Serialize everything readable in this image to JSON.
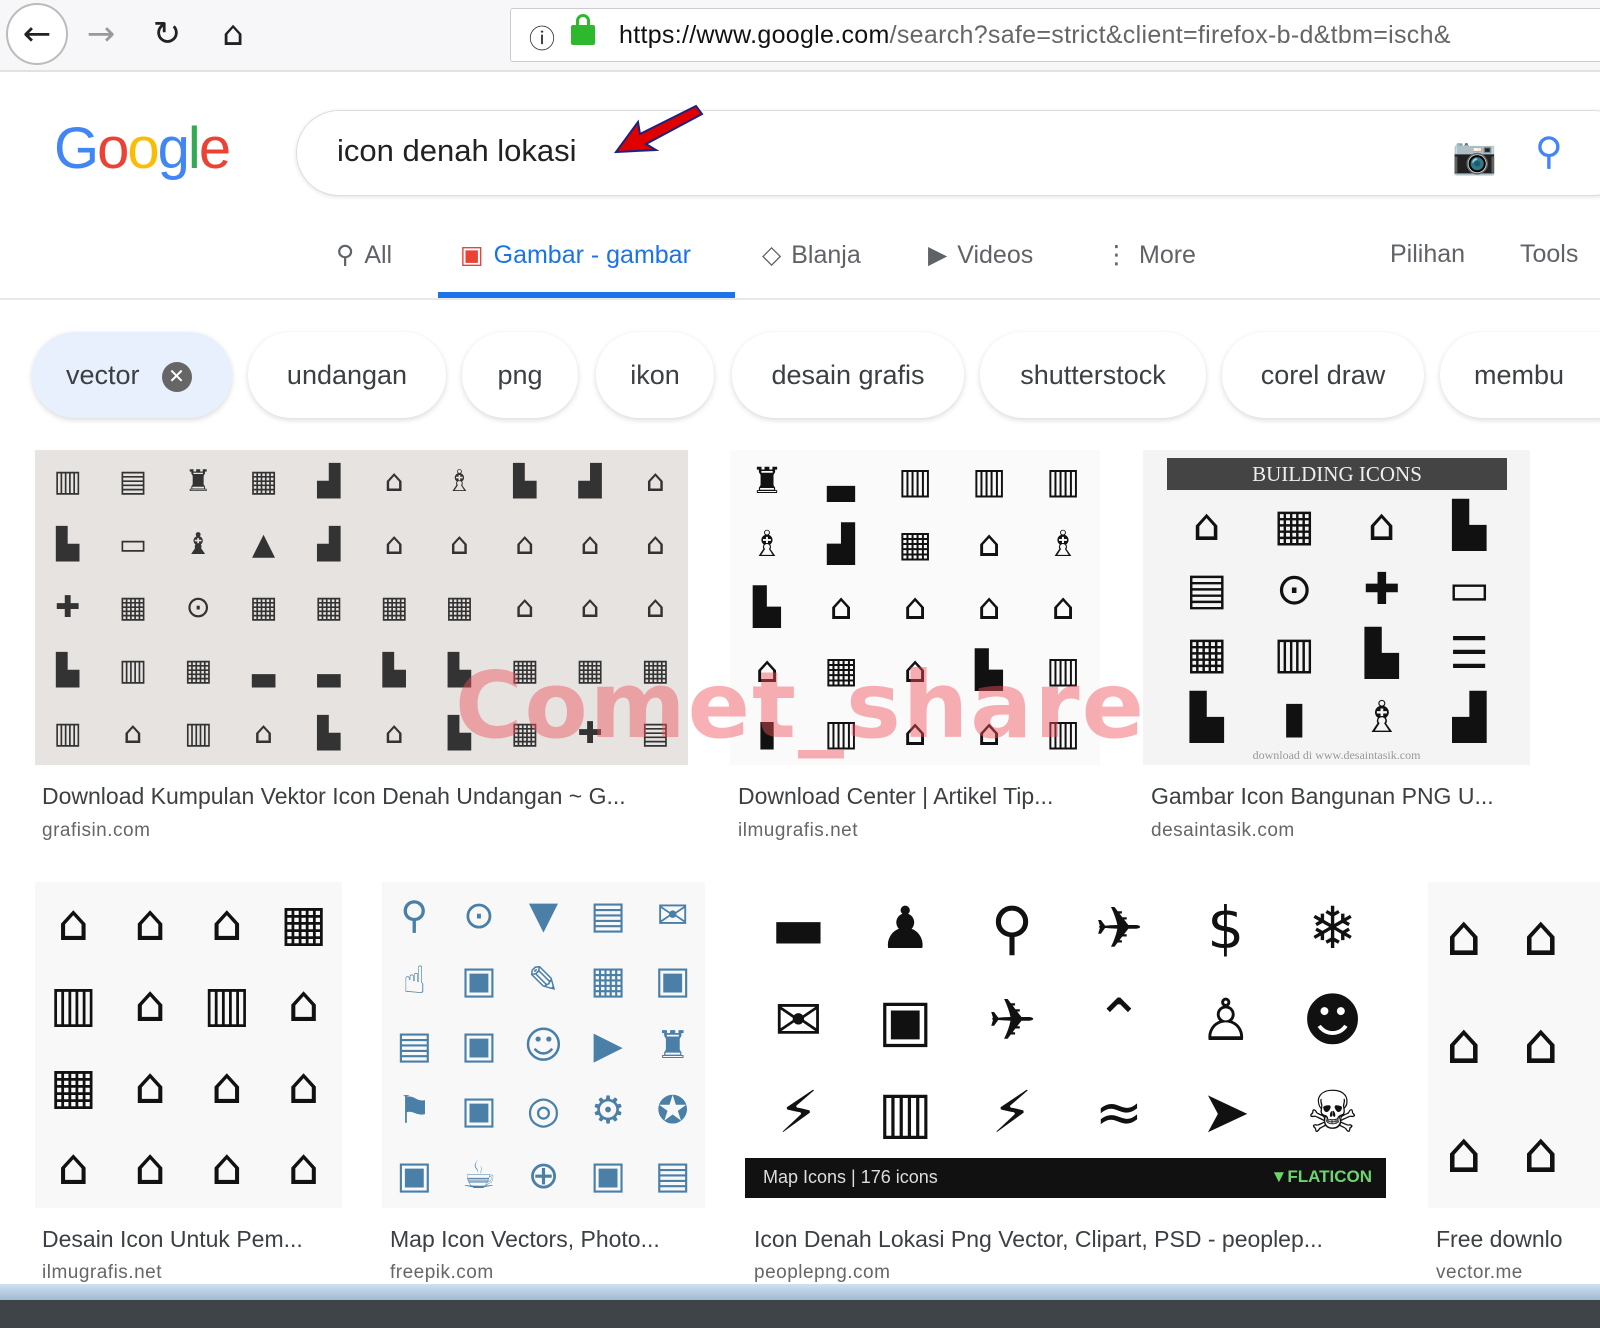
{
  "browser": {
    "url_host": "https://www.google.com",
    "url_path": "/search?safe=strict&client=firefox-b-d&tbm=isch&",
    "icons": [
      "back-icon",
      "forward-icon",
      "reload-icon",
      "home-icon",
      "info-icon",
      "lock-icon"
    ]
  },
  "google": {
    "logo": "Google",
    "query": "icon denah lokasi"
  },
  "tabs": [
    {
      "label": "All",
      "icon": "search-icon"
    },
    {
      "label": "Gambar - gambar",
      "icon": "image-icon",
      "active": true
    },
    {
      "label": "Blanja",
      "icon": "tag-icon"
    },
    {
      "label": "Videos",
      "icon": "play-icon"
    },
    {
      "label": "More",
      "icon": "more-vert-icon"
    }
  ],
  "tools": {
    "pilihan": "Pilihan",
    "tools": "Tools"
  },
  "chips": [
    {
      "label": "vector",
      "selected": true
    },
    {
      "label": "undangan"
    },
    {
      "label": "png"
    },
    {
      "label": "ikon"
    },
    {
      "label": "desain grafis"
    },
    {
      "label": "shutterstock"
    },
    {
      "label": "corel draw"
    },
    {
      "label": "membu"
    }
  ],
  "results": [
    {
      "title": "Download Kumpulan Vektor Icon Denah Undangan ~ G...",
      "source": "grafisin.com"
    },
    {
      "title": "Download Center | Artikel Tip...",
      "source": "ilmugrafis.net"
    },
    {
      "title": "Gambar Icon Bangunan PNG U...",
      "source": "desaintasik.com",
      "heading": "BUILDING ICONS",
      "footer": "download di www.desaintasik.com"
    },
    {
      "title": "Desain Icon Untuk Pem...",
      "source": "ilmugrafis.net"
    },
    {
      "title": "Map Icon Vectors, Photo...",
      "source": "freepik.com"
    },
    {
      "title": "Icon Denah Lokasi Png Vector, Clipart, PSD - peoplep...",
      "source": "peoplepng.com",
      "caption": "Map Icons | 176 icons",
      "brand": "FLATICON"
    },
    {
      "title": "Free downlo",
      "source": "vector.me"
    }
  ],
  "watermark": "Comet_share",
  "colors": {
    "accent": "#1a73e8",
    "chip_selected": "#e8f0fe",
    "annotation_arrow": "#e00000"
  }
}
